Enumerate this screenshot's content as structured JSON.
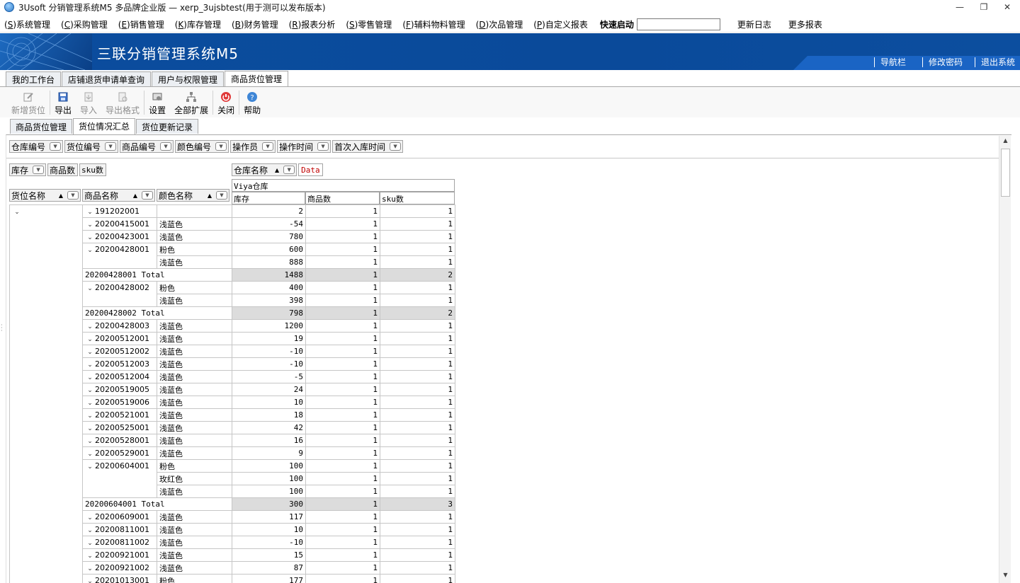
{
  "window": {
    "title": "3Usoft 分销管理系统M5 多品牌企业版 — xerp_3ujsbtest(用于测可以发布版本)",
    "controls": {
      "minimize": "—",
      "restore": "❐",
      "close": "✕"
    }
  },
  "menu": {
    "items": [
      {
        "key": "S",
        "label": "系统管理"
      },
      {
        "key": "C",
        "label": "采购管理"
      },
      {
        "key": "E",
        "label": "销售管理"
      },
      {
        "key": "K",
        "label": "库存管理"
      },
      {
        "key": "B",
        "label": "财务管理"
      },
      {
        "key": "R",
        "label": "报表分析"
      },
      {
        "key": "S",
        "label": "零售管理"
      },
      {
        "key": "F",
        "label": "辅料物料管理"
      },
      {
        "key": "D",
        "label": "次品管理"
      },
      {
        "key": "P",
        "label": "自定义报表"
      }
    ],
    "quick_start_label": "快速启动",
    "quick_start_value": "",
    "changelog": "更新日志",
    "more_reports": "更多报表"
  },
  "banner": {
    "brand": "三联分销管理系统M5",
    "links": [
      "导航栏",
      "修改密码",
      "退出系统"
    ]
  },
  "main_tabs": [
    "我的工作台",
    "店铺退货申请单查询",
    "用户与权限管理",
    "商品货位管理"
  ],
  "toolbar": [
    {
      "label": "新增货位",
      "icon": "edit-icon",
      "disabled": true
    },
    {
      "label": "导出",
      "icon": "save-icon",
      "disabled": false
    },
    {
      "label": "导入",
      "icon": "import-icon",
      "disabled": true
    },
    {
      "label": "导出格式",
      "icon": "export-format-icon",
      "disabled": true
    },
    {
      "label": "设置",
      "icon": "settings-icon",
      "disabled": false
    },
    {
      "label": "全部扩展",
      "icon": "expand-all-icon",
      "disabled": false
    },
    {
      "label": "关闭",
      "icon": "power-icon",
      "disabled": false
    },
    {
      "label": "帮助",
      "icon": "help-icon",
      "disabled": false
    }
  ],
  "sub_tabs": [
    "商品货位管理",
    "货位情况汇总",
    "货位更新记录"
  ],
  "pivot": {
    "filter_fields": [
      "仓库编号",
      "货位编号",
      "商品编号",
      "颜色编号",
      "操作员",
      "操作时间",
      "首次入库时间"
    ],
    "data_fields": [
      "库存",
      "商品数",
      "sku数"
    ],
    "column_field": "仓库名称",
    "data_label": "Data",
    "row_fields": [
      "货位名称",
      "商品名称",
      "颜色名称"
    ],
    "warehouse": "Viya仓库",
    "value_headers": [
      "库存",
      "商品数",
      "sku数"
    ],
    "rows": [
      {
        "type": "item",
        "code": "191202001",
        "color": "",
        "stock": "2",
        "products": "1",
        "sku": "1"
      },
      {
        "type": "item",
        "code": "20200415001",
        "color": "浅蓝色",
        "stock": "-54",
        "products": "1",
        "sku": "1"
      },
      {
        "type": "item",
        "code": "20200423001",
        "color": "浅蓝色",
        "stock": "780",
        "products": "1",
        "sku": "1"
      },
      {
        "type": "item",
        "code": "20200428001",
        "color": "粉色",
        "stock": "600",
        "products": "1",
        "sku": "1"
      },
      {
        "type": "cont",
        "code": "",
        "color": "浅蓝色",
        "stock": "888",
        "products": "1",
        "sku": "1"
      },
      {
        "type": "total",
        "code": "20200428001 Total",
        "color": "",
        "stock": "1488",
        "products": "1",
        "sku": "2"
      },
      {
        "type": "item",
        "code": "20200428002",
        "color": "粉色",
        "stock": "400",
        "products": "1",
        "sku": "1"
      },
      {
        "type": "cont",
        "code": "",
        "color": "浅蓝色",
        "stock": "398",
        "products": "1",
        "sku": "1"
      },
      {
        "type": "total",
        "code": "20200428002 Total",
        "color": "",
        "stock": "798",
        "products": "1",
        "sku": "2"
      },
      {
        "type": "item",
        "code": "20200428003",
        "color": "浅蓝色",
        "stock": "1200",
        "products": "1",
        "sku": "1"
      },
      {
        "type": "item",
        "code": "20200512001",
        "color": "浅蓝色",
        "stock": "19",
        "products": "1",
        "sku": "1"
      },
      {
        "type": "item",
        "code": "20200512002",
        "color": "浅蓝色",
        "stock": "-10",
        "products": "1",
        "sku": "1"
      },
      {
        "type": "item",
        "code": "20200512003",
        "color": "浅蓝色",
        "stock": "-10",
        "products": "1",
        "sku": "1"
      },
      {
        "type": "item",
        "code": "20200512004",
        "color": "浅蓝色",
        "stock": "-5",
        "products": "1",
        "sku": "1"
      },
      {
        "type": "item",
        "code": "20200519005",
        "color": "浅蓝色",
        "stock": "24",
        "products": "1",
        "sku": "1"
      },
      {
        "type": "item",
        "code": "20200519006",
        "color": "浅蓝色",
        "stock": "10",
        "products": "1",
        "sku": "1"
      },
      {
        "type": "item",
        "code": "20200521001",
        "color": "浅蓝色",
        "stock": "18",
        "products": "1",
        "sku": "1"
      },
      {
        "type": "item",
        "code": "20200525001",
        "color": "浅蓝色",
        "stock": "42",
        "products": "1",
        "sku": "1"
      },
      {
        "type": "item",
        "code": "20200528001",
        "color": "浅蓝色",
        "stock": "16",
        "products": "1",
        "sku": "1"
      },
      {
        "type": "item",
        "code": "20200529001",
        "color": "浅蓝色",
        "stock": "9",
        "products": "1",
        "sku": "1"
      },
      {
        "type": "item",
        "code": "20200604001",
        "color": "粉色",
        "stock": "100",
        "products": "1",
        "sku": "1"
      },
      {
        "type": "cont",
        "code": "",
        "color": "玫红色",
        "stock": "100",
        "products": "1",
        "sku": "1"
      },
      {
        "type": "cont",
        "code": "",
        "color": "浅蓝色",
        "stock": "100",
        "products": "1",
        "sku": "1"
      },
      {
        "type": "total",
        "code": "20200604001 Total",
        "color": "",
        "stock": "300",
        "products": "1",
        "sku": "3"
      },
      {
        "type": "item",
        "code": "20200609001",
        "color": "浅蓝色",
        "stock": "117",
        "products": "1",
        "sku": "1"
      },
      {
        "type": "item",
        "code": "20200811001",
        "color": "浅蓝色",
        "stock": "10",
        "products": "1",
        "sku": "1"
      },
      {
        "type": "item",
        "code": "20200811002",
        "color": "浅蓝色",
        "stock": "-10",
        "products": "1",
        "sku": "1"
      },
      {
        "type": "item",
        "code": "20200921001",
        "color": "浅蓝色",
        "stock": "15",
        "products": "1",
        "sku": "1"
      },
      {
        "type": "item",
        "code": "20200921002",
        "color": "浅蓝色",
        "stock": "87",
        "products": "1",
        "sku": "1"
      },
      {
        "type": "item",
        "code": "20201013001",
        "color": "粉色",
        "stock": "177",
        "products": "1",
        "sku": "1"
      }
    ]
  }
}
